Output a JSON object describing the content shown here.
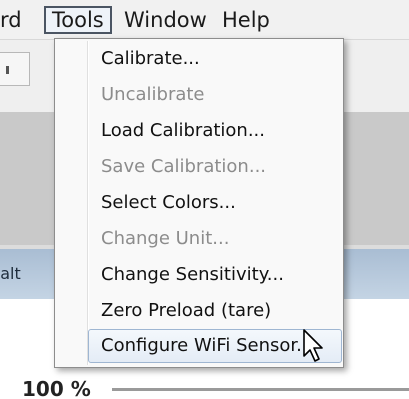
{
  "menubar": {
    "items": [
      {
        "label": "rd",
        "active": false
      },
      {
        "label": "Tools",
        "active": true
      },
      {
        "label": "Window",
        "active": false
      },
      {
        "label": "Help",
        "active": false
      }
    ]
  },
  "background": {
    "status_text": "Realt",
    "percent_label": "100 %"
  },
  "tools_menu": {
    "items": [
      {
        "label": "Calibrate...",
        "enabled": true
      },
      {
        "label": "Uncalibrate",
        "enabled": false
      },
      {
        "label": "Load Calibration...",
        "enabled": true
      },
      {
        "label": "Save Calibration...",
        "enabled": false
      },
      {
        "label": "Select Colors...",
        "enabled": true
      },
      {
        "label": "Change Unit...",
        "enabled": false
      },
      {
        "label": "Change Sensitivity...",
        "enabled": true
      },
      {
        "label": "Zero Preload (tare)",
        "enabled": true
      },
      {
        "label": "Configure WiFi Sensor...",
        "enabled": true,
        "hovered": true
      }
    ]
  },
  "cursor": {
    "icon": "arrow-pointer-icon"
  }
}
